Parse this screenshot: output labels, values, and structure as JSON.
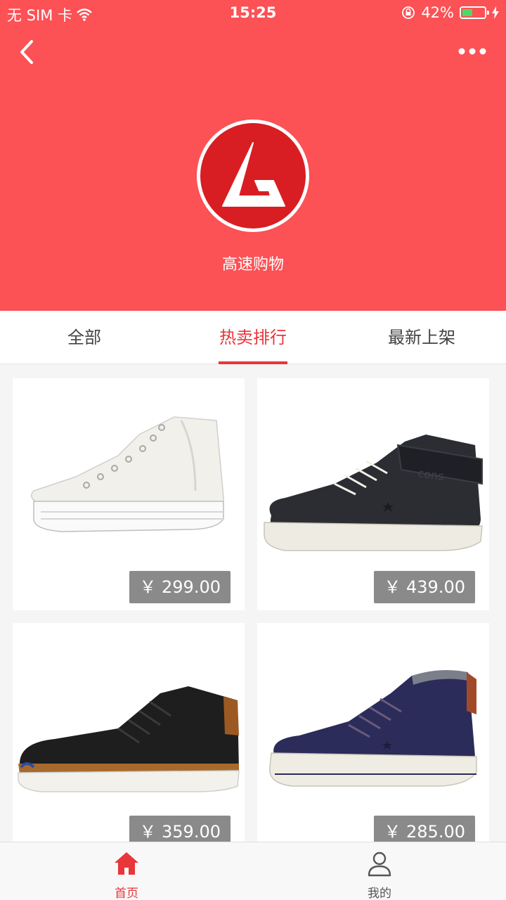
{
  "status_bar": {
    "carrier": "无 SIM 卡",
    "time": "15:25",
    "battery": "42%"
  },
  "shop": {
    "name": "高速购物"
  },
  "tabs": [
    {
      "label": "全部",
      "active": false
    },
    {
      "label": "热卖排行",
      "active": true
    },
    {
      "label": "最新上架",
      "active": false
    }
  ],
  "products": [
    {
      "price": "￥ 299.00",
      "image": "white-high-top-sneaker"
    },
    {
      "price": "￥ 439.00",
      "image": "black-strap-sneaker"
    },
    {
      "price": "￥ 359.00",
      "image": "black-leather-sneaker"
    },
    {
      "price": "￥ 285.00",
      "image": "navy-suede-sneaker"
    }
  ],
  "bottom_nav": [
    {
      "label": "首页",
      "icon": "home-icon",
      "active": true
    },
    {
      "label": "我的",
      "icon": "user-icon",
      "active": false
    }
  ],
  "colors": {
    "brand": "#fc5155",
    "accent": "#e8363b",
    "price_bg": "#8a8a8a"
  }
}
